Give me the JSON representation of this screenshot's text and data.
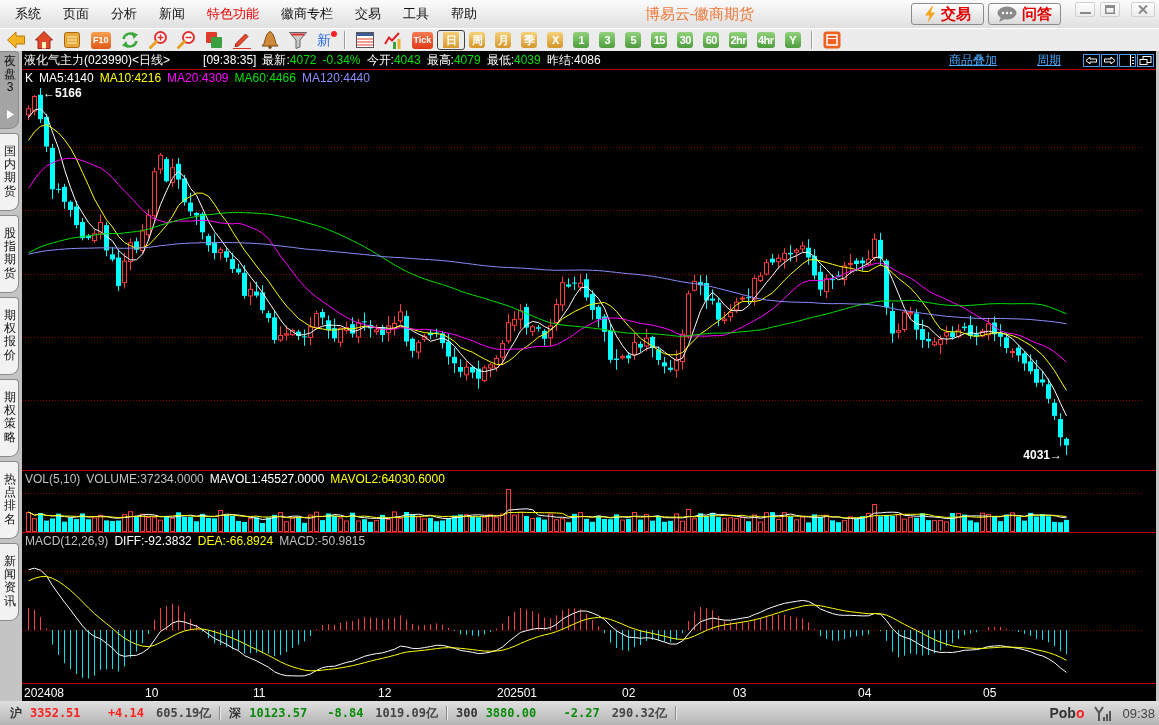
{
  "window": {
    "title": "博易云-徽商期货"
  },
  "menu": [
    {
      "label": "系统",
      "highlighted": false
    },
    {
      "label": "页面",
      "highlighted": false
    },
    {
      "label": "分析",
      "highlighted": false
    },
    {
      "label": "新闻",
      "highlighted": false
    },
    {
      "label": "特色功能",
      "highlighted": true
    },
    {
      "label": "徽商专栏",
      "highlighted": false
    },
    {
      "label": "交易",
      "highlighted": false
    },
    {
      "label": "工具",
      "highlighted": false
    },
    {
      "label": "帮助",
      "highlighted": false
    }
  ],
  "header_buttons": [
    {
      "kind": "trade",
      "label": "交易"
    },
    {
      "kind": "qa",
      "label": "问答"
    }
  ],
  "toolbar": {
    "f10_label": "F10",
    "news_label": "新",
    "news_unread": true,
    "tick_label": "Tick",
    "periods": [
      {
        "label": "日",
        "kind": "calendar",
        "selected": true
      },
      {
        "label": "周",
        "kind": "calendar",
        "selected": false
      },
      {
        "label": "月",
        "kind": "calendar",
        "selected": false
      },
      {
        "label": "季",
        "kind": "calendar",
        "selected": false
      },
      {
        "label": "X",
        "kind": "calendar",
        "selected": false
      },
      {
        "label": "1",
        "kind": "minute",
        "selected": false
      },
      {
        "label": "3",
        "kind": "minute",
        "selected": false
      },
      {
        "label": "5",
        "kind": "minute",
        "selected": false
      },
      {
        "label": "15",
        "kind": "minute",
        "selected": false
      },
      {
        "label": "30",
        "kind": "minute",
        "selected": false
      },
      {
        "label": "60",
        "kind": "minute",
        "selected": false
      },
      {
        "label": "2hr",
        "kind": "minute",
        "selected": false
      },
      {
        "label": "4hr",
        "kind": "minute",
        "selected": false
      },
      {
        "label": "Y",
        "kind": "minute",
        "selected": false
      }
    ]
  },
  "side_tabs": [
    {
      "label": "夜盘3",
      "selected": true
    },
    {
      "label": "国内期货",
      "selected": false
    },
    {
      "label": "股指期货",
      "selected": false
    },
    {
      "label": "期权报价",
      "selected": false
    },
    {
      "label": "期权策略",
      "selected": false
    },
    {
      "label": "热点排名",
      "selected": false
    },
    {
      "label": "新闻资讯",
      "selected": false
    }
  ],
  "quote": {
    "title": "液化气主力(023990)<日线>",
    "time": "[09:38:35]",
    "fields": [
      {
        "label": "最新:",
        "value": "4072",
        "change": "-0.34%",
        "color": "#00e000"
      },
      {
        "label": "今开:",
        "value": "4043",
        "color": "#00e000"
      },
      {
        "label": "最高:",
        "value": "4079",
        "color": "#00e000"
      },
      {
        "label": "最低:",
        "value": "4039",
        "color": "#00e000"
      },
      {
        "label": "昨结:",
        "value": "4086",
        "color": "#ffffff"
      }
    ],
    "links": [
      "商品叠加",
      "周期"
    ]
  },
  "price_panel": {
    "label": "K",
    "moving_averages": [
      {
        "text": "MA5:4140",
        "color": "#ffffff"
      },
      {
        "text": "MA10:4216",
        "color": "#ffff00"
      },
      {
        "text": "MA20:4309",
        "color": "#ff00ff"
      },
      {
        "text": "MA60:4466",
        "color": "#00e000"
      },
      {
        "text": "MA120:4440",
        "color": "#8c8cff"
      }
    ],
    "high_label": "←5166",
    "low_label": "4031→"
  },
  "volume_panel": {
    "legend": [
      {
        "text": "VOL(5,10)",
        "color": "#c0c0c0"
      },
      {
        "text": "VOLUME:37234.0000",
        "color": "#c0c0c0"
      },
      {
        "text": "MAVOL1:45527.0000",
        "color": "#ffffff"
      },
      {
        "text": "MAVOL2:64030.6000",
        "color": "#ffff00"
      }
    ]
  },
  "macd_panel": {
    "legend": [
      {
        "text": "MACD(12,26,9)",
        "color": "#c0c0c0"
      },
      {
        "text": "DIFF:-92.3832",
        "color": "#ffffff"
      },
      {
        "text": "DEA:-66.8924",
        "color": "#ffff00"
      },
      {
        "text": "MACD:-50.9815",
        "color": "#c0c0c0"
      }
    ]
  },
  "x_axis": [
    "202408",
    "10",
    "11",
    "12",
    "202501",
    "02",
    "03",
    "04",
    "05"
  ],
  "status_bar": {
    "indices": [
      {
        "name": "沪",
        "value": "3352.51",
        "change": "+4.14",
        "amount": "605.19亿",
        "color": "#ff2020"
      },
      {
        "name": "深",
        "value": "10123.57",
        "change": "-8.84",
        "amount": "1019.09亿",
        "color": "#0a8a0a"
      },
      {
        "name": "300",
        "value": "3880.00",
        "change": "-2.27",
        "amount": "290.32亿",
        "color": "#0a8a0a"
      }
    ],
    "logo": {
      "text": "Pob",
      "accent": "o"
    },
    "time": "09:38"
  }
}
